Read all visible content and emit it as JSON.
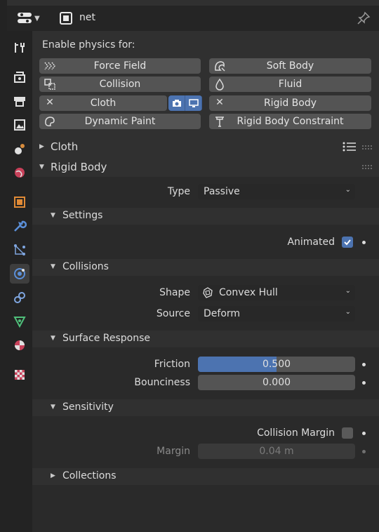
{
  "header": {
    "object_name": "net",
    "editor_type_icon": "editor-type-icon",
    "object_icon": "object-icon",
    "pin_icon": "pin-icon"
  },
  "tabs": [
    {
      "name": "tool-tab",
      "icon": "tool-icon",
      "active": false
    },
    {
      "name": "render-tab",
      "icon": "render-icon",
      "active": false
    },
    {
      "name": "output-tab",
      "icon": "output-icon",
      "active": false
    },
    {
      "name": "view-layer-tab",
      "icon": "view-layer-icon",
      "active": false
    },
    {
      "name": "scene-tab",
      "icon": "scene-icon",
      "active": false
    },
    {
      "name": "world-tab",
      "icon": "world-icon",
      "active": false
    },
    {
      "name": "object-tab",
      "icon": "object-icon",
      "active": false
    },
    {
      "name": "modifier-tab",
      "icon": "wrench-icon",
      "active": false
    },
    {
      "name": "particles-tab",
      "icon": "particles-icon",
      "active": false
    },
    {
      "name": "physics-tab",
      "icon": "physics-icon",
      "active": true
    },
    {
      "name": "constraints-tab",
      "icon": "constraint-icon",
      "active": false
    },
    {
      "name": "data-tab",
      "icon": "mesh-data-icon",
      "active": false
    },
    {
      "name": "material-tab",
      "icon": "material-icon",
      "active": false
    },
    {
      "name": "texture-tab",
      "icon": "texture-icon",
      "active": false
    }
  ],
  "physics": {
    "enable_title": "Enable physics for:",
    "buttons": {
      "force_field": "Force Field",
      "soft_body": "Soft Body",
      "collision": "Collision",
      "fluid": "Fluid",
      "cloth": "Cloth",
      "rigid_body": "Rigid Body",
      "dynamic_paint": "Dynamic Paint",
      "rigid_body_constraint": "Rigid Body Constraint"
    }
  },
  "sections": {
    "cloth": "Cloth",
    "rigid_body": "Rigid Body"
  },
  "rigid_body": {
    "type_label": "Type",
    "type_value": "Passive",
    "settings": {
      "title": "Settings",
      "animated_label": "Animated",
      "animated": true
    },
    "collisions": {
      "title": "Collisions",
      "shape_label": "Shape",
      "shape_value": "Convex Hull",
      "source_label": "Source",
      "source_value": "Deform"
    },
    "surface_response": {
      "title": "Surface Response",
      "friction_label": "Friction",
      "friction_value": "0.500",
      "friction_fraction": 0.5,
      "bounciness_label": "Bounciness",
      "bounciness_value": "0.000"
    },
    "sensitivity": {
      "title": "Sensitivity",
      "collision_margin_label": "Collision Margin",
      "collision_margin_enabled": false,
      "margin_label": "Margin",
      "margin_value": "0.04 m"
    },
    "collections": {
      "title": "Collections"
    }
  },
  "colors": {
    "accent": "#4c73b0",
    "button": "#545454",
    "panel": "#303030",
    "subpanel": "#2a2a2a"
  }
}
